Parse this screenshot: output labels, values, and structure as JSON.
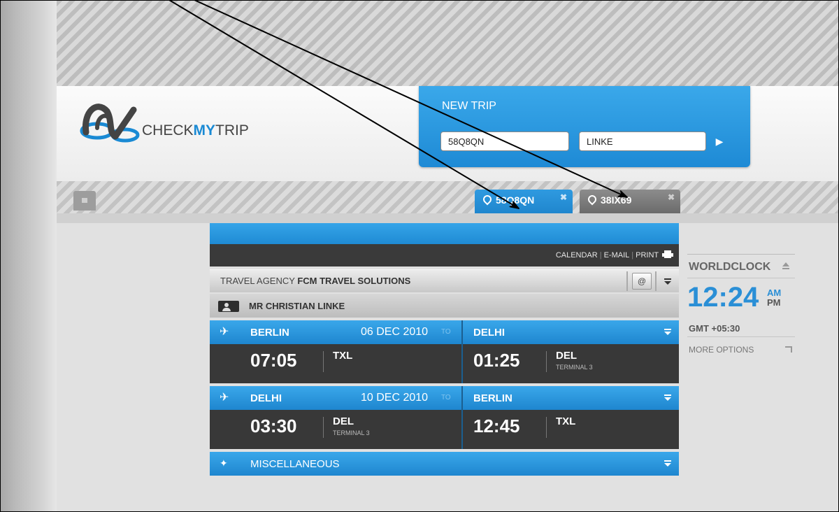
{
  "logo": {
    "check": "CHECK",
    "my": "MY",
    "trip": "TRIP"
  },
  "new_trip": {
    "title": "NEW TRIP",
    "booking_value": "58Q8QN",
    "name_value": "LINKE",
    "go": "▶"
  },
  "tabs": [
    {
      "label": "58Q8QN",
      "close": "✖"
    },
    {
      "label": "38IX69",
      "close": "✖"
    }
  ],
  "panel_links": {
    "calendar": "CALENDAR",
    "email": "E-MAIL",
    "print": "PRINT"
  },
  "agency": {
    "prefix": "TRAVEL AGENCY",
    "name": "FCM TRAVEL SOLUTIONS",
    "email_icon": "@"
  },
  "passenger": "MR CHRISTIAN LINKE",
  "flights": [
    {
      "from_city": "BERLIN",
      "date": "06 DEC 2010",
      "to_word": "TO",
      "to_city": "DELHI",
      "dep_time": "07:05",
      "dep_code": "TXL",
      "dep_terminal": "",
      "arr_time": "01:25",
      "arr_code": "DEL",
      "arr_terminal": "TERMINAL 3"
    },
    {
      "from_city": "DELHI",
      "date": "10 DEC 2010",
      "to_word": "TO",
      "to_city": "BERLIN",
      "dep_time": "03:30",
      "dep_code": "DEL",
      "dep_terminal": "TERMINAL 3",
      "arr_time": "12:45",
      "arr_code": "TXL",
      "arr_terminal": ""
    }
  ],
  "misc": "MISCELLANEOUS",
  "worldclock": {
    "title": "WORLDCLOCK",
    "time": "12:24",
    "am": "AM",
    "pm": "PM",
    "gmt": "GMT +05:30",
    "more": "MORE OPTIONS"
  },
  "colors": {
    "accent": "#1e8ad5",
    "dark_bar": "#383838"
  },
  "icons": [
    "plane-icon",
    "pin-icon",
    "close-icon",
    "menu-icon",
    "printer-icon",
    "person-icon",
    "stars-icon",
    "eject-icon",
    "home-icon"
  ]
}
